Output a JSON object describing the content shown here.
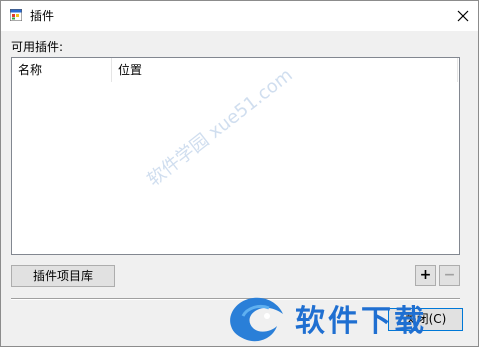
{
  "window": {
    "title": "插件",
    "close_glyph": "✕"
  },
  "main": {
    "section_label": "可用插件:",
    "list_columns": [
      "名称",
      "位置"
    ]
  },
  "buttons": {
    "repository": "插件项目库",
    "add": "+",
    "remove": "−",
    "close": "关闭(C)"
  },
  "watermark": {
    "logo_text": "软件下载",
    "diagonal_text": "软件学园 xue51.com"
  },
  "icons": {
    "app": "app-window-icon",
    "close": "close-icon",
    "watermark": "dragon-logo-icon"
  },
  "colors": {
    "titlebar_bg": "#ffffff",
    "window_bg": "#f0f0f0",
    "button_bg": "#e1e1e1",
    "focus_border": "#0078d7",
    "watermark_blue": "#1f6fd1"
  }
}
